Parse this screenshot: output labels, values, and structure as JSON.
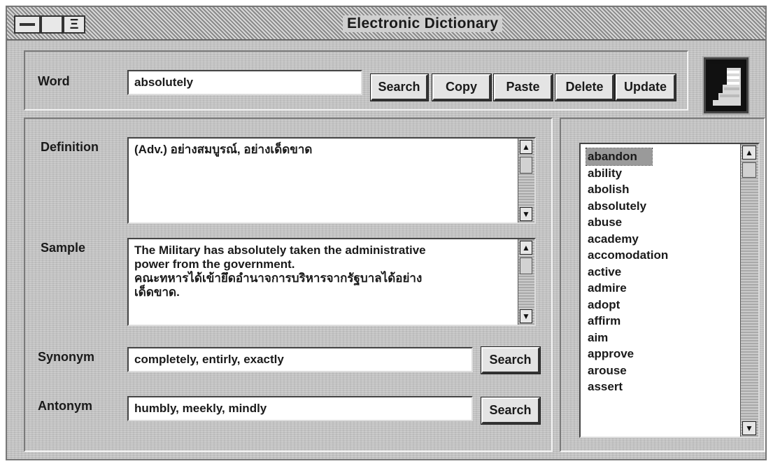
{
  "window": {
    "title": "Electronic Dictionary"
  },
  "word": {
    "label": "Word",
    "value": "absolutely"
  },
  "toolbar": {
    "search_label": "Search",
    "copy_label": "Copy",
    "paste_label": "Paste",
    "delete_label": "Delete",
    "update_label": "Update"
  },
  "definition": {
    "label": "Definition",
    "text": "(Adv.) อย่างสมบูรณ์, อย่างเด็ดขาด"
  },
  "sample": {
    "label": "Sample",
    "lines": [
      "The Military has absolutely taken the administrative",
      "power from the government.",
      "คณะทหารได้เข้ายึดอำนาจการบริหารจากรัฐบาลได้อย่าง",
      "เด็ดขาด."
    ]
  },
  "synonym": {
    "label": "Synonym",
    "value": "completely, entirly, exactly",
    "search_label": "Search"
  },
  "antonym": {
    "label": "Antonym",
    "value": "humbly, meekly, mindly",
    "search_label": "Search"
  },
  "wordlist": {
    "selected": "abandon",
    "items": [
      "abandon",
      "ability",
      "abolish",
      "absolutely",
      "abuse",
      "academy",
      "accomodation",
      "active",
      "admire",
      "adopt",
      "affirm",
      "aim",
      "approve",
      "arouse",
      "assert"
    ]
  },
  "icons": {
    "system_menu": "system-menu-icon",
    "control": "control-box-icon",
    "logo": "app-logo-icon",
    "scroll_up": "arrow-up-icon",
    "scroll_down": "arrow-down-icon"
  },
  "glyphs": {
    "up": "▲",
    "down": "▼",
    "ctrl": "Ξ"
  }
}
